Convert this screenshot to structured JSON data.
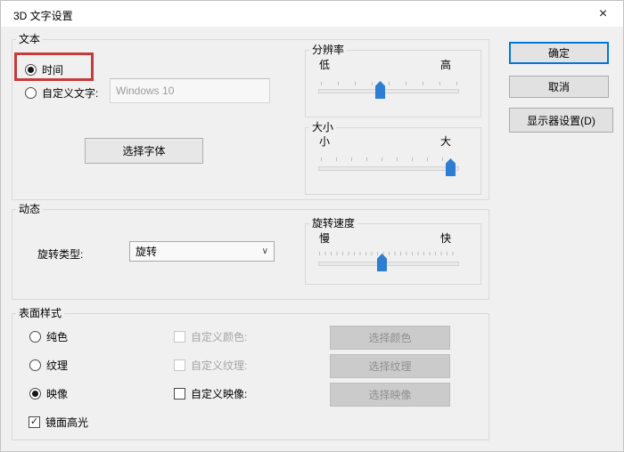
{
  "window": {
    "title": "3D 文字设置"
  },
  "icons": {
    "close": "×",
    "check": "✓",
    "chevron_down": "∨"
  },
  "colors": {
    "accent_blue": "#0078d7",
    "slider_thumb_blue": "#2d7dd2",
    "annotation_red": "#c43c3c",
    "dialog_bg": "#f0f0f0",
    "titlebar_bg": "#ffffff"
  },
  "text_group": {
    "label": "文本",
    "time_radio_label": "时间",
    "custom_radio_label": "自定义文字:",
    "custom_text_value": "Windows 10",
    "choose_font_button": "选择字体"
  },
  "resolution_group": {
    "label": "分辨率",
    "low_label": "低",
    "high_label": "高",
    "value_percent": 45
  },
  "size_group": {
    "label": "大小",
    "small_label": "小",
    "large_label": "大",
    "value_percent": 96
  },
  "motion_group": {
    "label": "动态",
    "rotation_type_label": "旋转类型:",
    "rotation_type_value": "旋转"
  },
  "speed_group": {
    "label": "旋转速度",
    "slow_label": "慢",
    "fast_label": "快",
    "value_percent": 46
  },
  "surface_group": {
    "label": "表面样式",
    "solid_radio_label": "纯色",
    "texture_radio_label": "纹理",
    "reflection_radio_label": "映像",
    "specular_checkbox_label": "镜面高光",
    "custom_color_label": "自定义颜色:",
    "custom_texture_label": "自定义纹理:",
    "custom_reflection_label": "自定义映像:",
    "choose_color_button": "选择颜色",
    "choose_texture_button": "选择纹理",
    "choose_reflection_button": "选择映像"
  },
  "states": {
    "time_selected": true,
    "custom_text_selected": false,
    "solid_selected": false,
    "texture_selected": false,
    "reflection_selected": true,
    "specular_checked": true,
    "custom_color_checked": false,
    "custom_color_enabled": false,
    "custom_texture_checked": false,
    "custom_texture_enabled": false,
    "custom_reflection_checked": false,
    "custom_reflection_enabled": true
  },
  "action_buttons": {
    "ok": "确定",
    "cancel": "取消",
    "display_settings": "显示器设置(D)"
  }
}
